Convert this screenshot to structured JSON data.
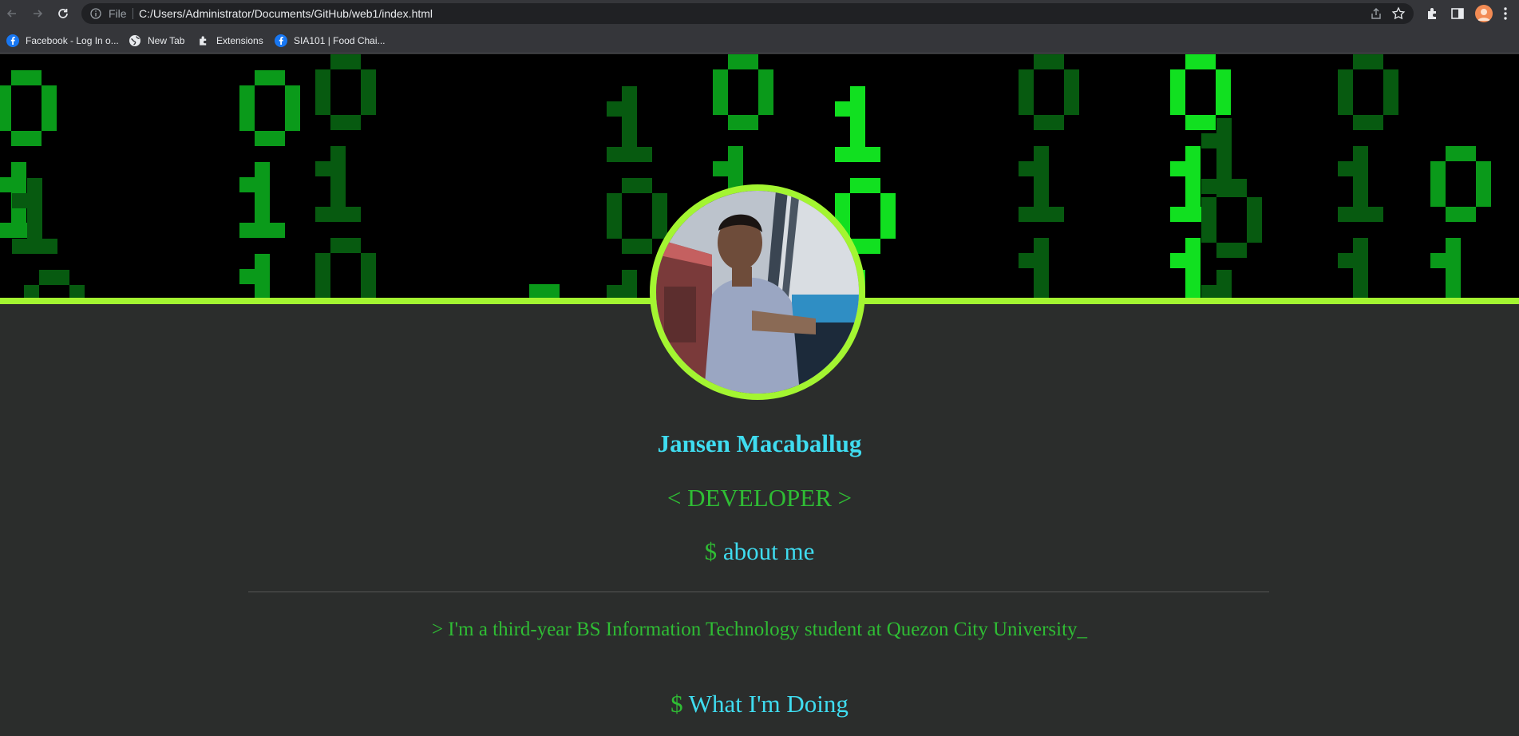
{
  "browser": {
    "omnibox": {
      "scheme_label": "File",
      "url": "C:/Users/Administrator/Documents/GitHub/web1/index.html"
    },
    "bookmarks": [
      {
        "label": "Facebook - Log In o...",
        "icon": "facebook-icon"
      },
      {
        "label": "New Tab",
        "icon": "globe-icon"
      },
      {
        "label": "Extensions",
        "icon": "puzzle-icon"
      },
      {
        "label": "SIA101 | Food Chai...",
        "icon": "facebook-icon"
      }
    ]
  },
  "page": {
    "name": "Jansen Macaballug",
    "role": "< DEVELOPER >",
    "about": {
      "prompt": "$",
      "title": "about me",
      "text": "> I'm a third-year BS Information Technology student at Quezon City University_"
    },
    "doing": {
      "prompt": "$",
      "title": "What I'm Doing"
    }
  },
  "colors": {
    "accent_line": "#a3f531",
    "name": "#3fdcf0",
    "terminal_green": "#2fbd34",
    "background": "#2b2d2c"
  }
}
